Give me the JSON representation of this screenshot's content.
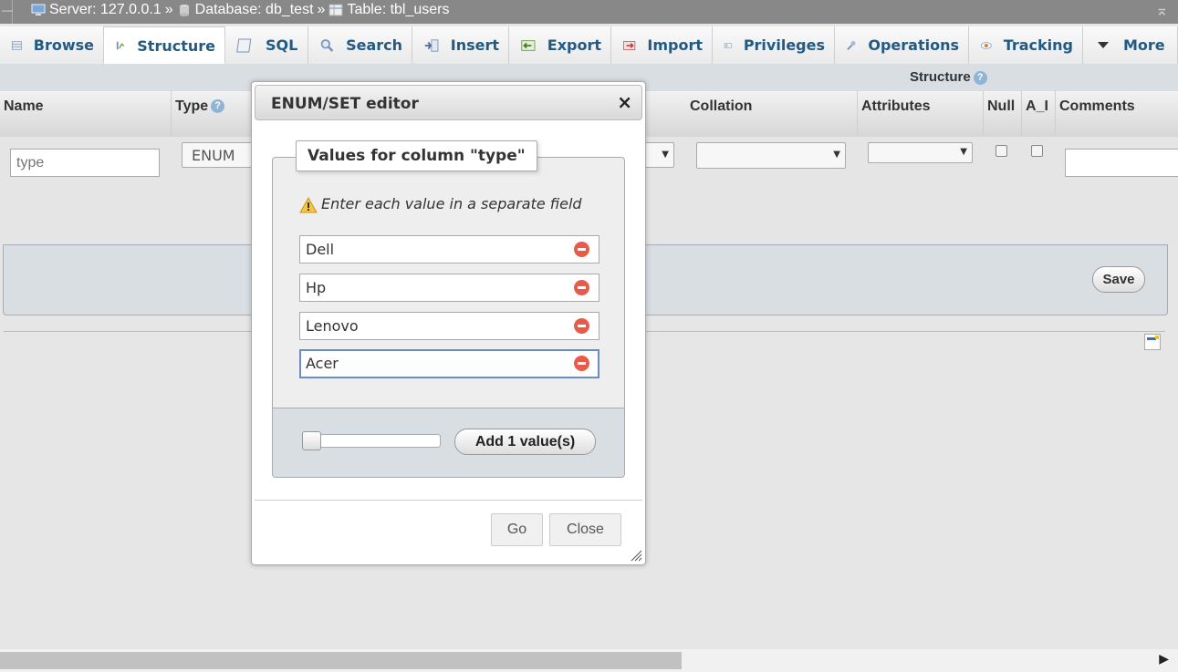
{
  "breadcrumb": {
    "server": "Server: 127.0.0.1",
    "database": "Database: db_test",
    "table": "Table: tbl_users",
    "separator": "»"
  },
  "tabs": [
    {
      "label": "Browse",
      "icon": "browse-icon"
    },
    {
      "label": "Structure",
      "icon": "structure-icon",
      "active": true
    },
    {
      "label": "SQL",
      "icon": "sql-icon"
    },
    {
      "label": "Search",
      "icon": "search-icon"
    },
    {
      "label": "Insert",
      "icon": "insert-icon"
    },
    {
      "label": "Export",
      "icon": "export-icon"
    },
    {
      "label": "Import",
      "icon": "import-icon"
    },
    {
      "label": "Privileges",
      "icon": "privileges-icon"
    },
    {
      "label": "Operations",
      "icon": "wrench-icon"
    },
    {
      "label": "Tracking",
      "icon": "eye-icon"
    },
    {
      "label": "More",
      "icon": "triangle-down-icon"
    }
  ],
  "structure_label": "Structure",
  "columns": {
    "name": "Name",
    "type": "Type",
    "collation": "Collation",
    "attributes": "Attributes",
    "null": "Null",
    "ai": "A_I",
    "comments": "Comments"
  },
  "row": {
    "name_placeholder": "type",
    "type_value": "ENUM"
  },
  "save_label": "Save",
  "dialog": {
    "title": "ENUM/SET editor",
    "legend": "Values for column \"type\"",
    "hint": "Enter each value in a separate field",
    "values": [
      "Dell",
      "Hp",
      "Lenovo",
      "Acer"
    ],
    "add_label": "Add 1 value(s)",
    "go_label": "Go",
    "close_label": "Close"
  },
  "colors": {
    "tab_text": "#235a81",
    "delete_icon": "#e85b4b",
    "focus_border": "#6b8cc7"
  }
}
